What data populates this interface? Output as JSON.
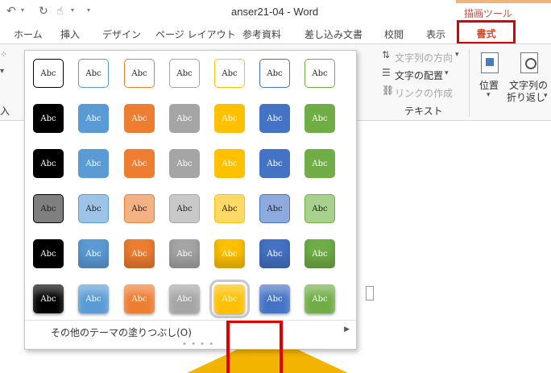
{
  "titlebar": {
    "doc_title": "anser21-04 - Word",
    "context_tab_label": "描画ツール",
    "qa_undo_icon": "undo-icon",
    "qa_redo_icon": "redo-icon",
    "qa_touch_icon": "touch-mode-icon"
  },
  "tabs": [
    {
      "label": "ホーム"
    },
    {
      "label": "挿入"
    },
    {
      "label": "デザイン"
    },
    {
      "label": "ページ レイアウト"
    },
    {
      "label": "参考資料"
    },
    {
      "label": "差し込み文書"
    },
    {
      "label": "校閲"
    },
    {
      "label": "表示"
    },
    {
      "label": "書式",
      "active": true,
      "color": "#d24726"
    }
  ],
  "ribbon": {
    "text_direction": "文字列の方向",
    "text_align": "文字の配置",
    "create_link": "リンクの作成",
    "text_group_label": "テキスト",
    "position_label": "位置",
    "wrap_label_1": "文字列の",
    "wrap_label_2": "折り返し",
    "left_group_label": "入"
  },
  "gallery": {
    "swatch_text": "Abc",
    "more_fills_label": "その他のテーマの塗りつぶし(O)",
    "theme_colors": [
      "#000000",
      "#5b9bd5",
      "#ed7d31",
      "#a5a5a5",
      "#ffc000",
      "#4472c4",
      "#70ad47"
    ],
    "light_colors": [
      "#7f7f7f",
      "#9dc3e6",
      "#f4b183",
      "#c9c9c9",
      "#ffd966",
      "#8faadc",
      "#a9d18e"
    ],
    "selected_row": 5,
    "selected_col": 4
  },
  "colors": {
    "highlight_red": "#e00000",
    "accent_orange": "#d24726"
  }
}
